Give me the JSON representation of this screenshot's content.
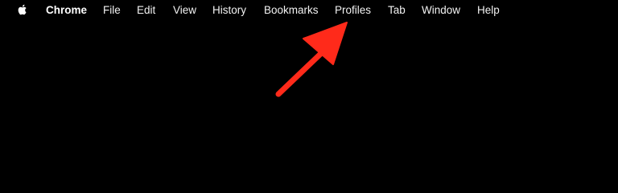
{
  "menubar": {
    "apple_icon": "apple-logo-icon",
    "app_name": "Chrome",
    "items": [
      "File",
      "Edit",
      "View",
      "History",
      "Bookmarks",
      "Profiles",
      "Tab",
      "Window",
      "Help"
    ]
  },
  "annotation": {
    "type": "arrow",
    "points_to": "Profiles",
    "color": "#ff2a1a"
  },
  "colors": {
    "background": "#000000",
    "menu_text": "#f2f2f2"
  }
}
